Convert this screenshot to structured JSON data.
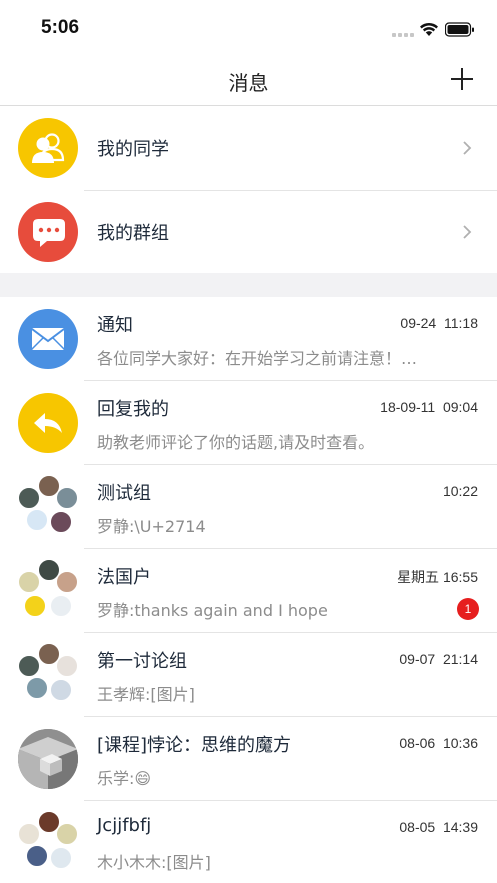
{
  "status_bar": {
    "time": "5:06"
  },
  "nav": {
    "title": "消息"
  },
  "shortcuts": [
    {
      "label": "我的同学",
      "icon": "classmates-icon",
      "color": "#f7c600"
    },
    {
      "label": "我的群组",
      "icon": "chat-bubbles-icon",
      "color": "#e74c3c"
    }
  ],
  "messages": [
    {
      "title": "通知",
      "time": "09-24  11:18",
      "preview": "各位同学大家好：在开始学习之前请注意！…",
      "avatar": "envelope-icon",
      "color": "#4a90e2"
    },
    {
      "title": "回复我的",
      "time": "18-09-11  09:04",
      "preview": "助教老师评论了你的话题,请及时查看。",
      "avatar": "reply-arrow-icon",
      "color": "#f7c600"
    },
    {
      "title": "测试组",
      "time": "10:22",
      "preview": "罗静:\\U+2714",
      "avatar": "group-avatar"
    },
    {
      "title": "法国户",
      "time": "星期五 16:55",
      "preview": "罗静:thanks again and I hope",
      "badge": "1",
      "avatar": "group-avatar"
    },
    {
      "title": "第一讨论组",
      "time": "09-07  21:14",
      "preview": "王孝辉:[图片]",
      "avatar": "group-avatar"
    },
    {
      "title": "[课程]悖论：思维的魔方",
      "time": "08-06  10:36",
      "preview": "乐学:😄",
      "avatar": "course-cube-avatar"
    },
    {
      "title": "Jcjjfbfj",
      "time": "08-05  14:39",
      "preview": "木小木木:[图片]",
      "avatar": "group-avatar"
    }
  ]
}
